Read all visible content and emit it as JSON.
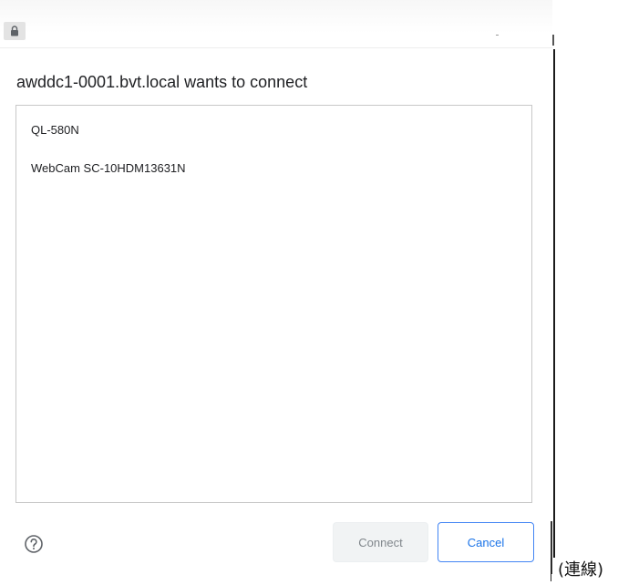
{
  "address_bar": {
    "lock_icon": "lock-icon"
  },
  "dialog": {
    "title": "awddc1-0001.bvt.local wants to connect",
    "devices": [
      {
        "label": "QL-580N"
      },
      {
        "label": "WebCam SC-10HDM13631N"
      }
    ],
    "help_icon": "help-circle-icon",
    "buttons": {
      "connect_label": "Connect",
      "cancel_label": "Cancel"
    },
    "colors": {
      "accent": "#1a73e8",
      "disabled_text": "#80868b",
      "disabled_bg": "#f1f3f4"
    }
  },
  "annotation": {
    "text": "(連線)"
  }
}
